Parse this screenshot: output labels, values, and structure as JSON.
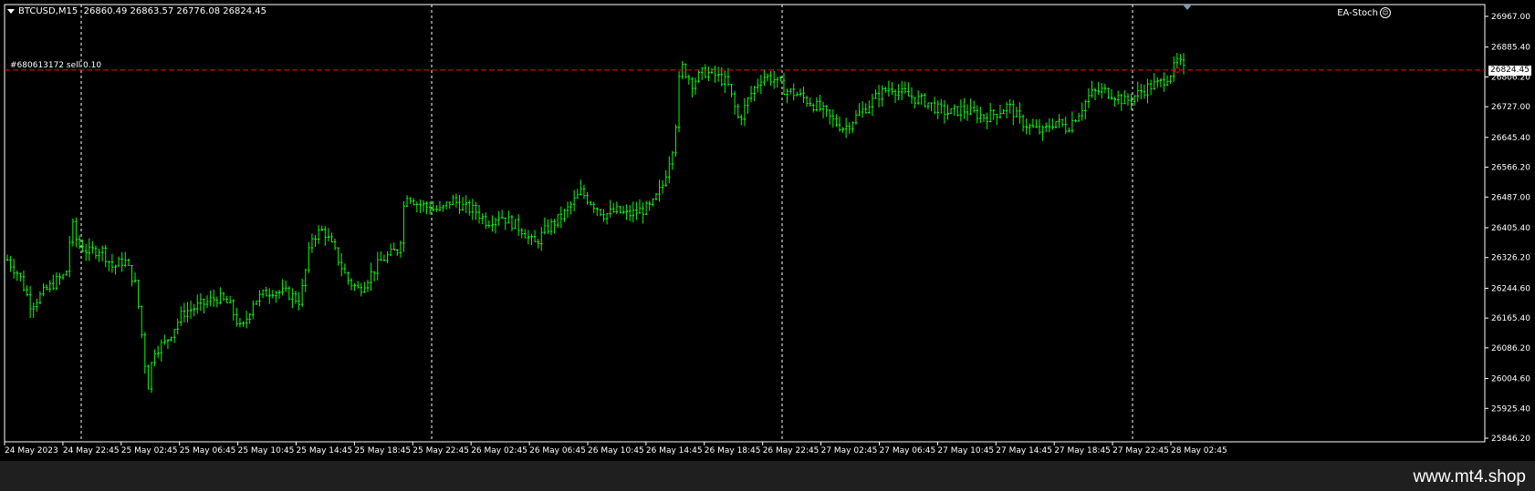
{
  "header": {
    "symbol_timeframe": "BTCUSD,M15",
    "ohlc": "26860.49 26863.57 26776.08 26824.45"
  },
  "expert": {
    "name": "EA-Stoch",
    "icon": "smiley-icon"
  },
  "order": {
    "label": "#680613172 sell 0.10",
    "price": 26824.45,
    "line_color": "#ff0000"
  },
  "current_price_label": "26824.45",
  "colors": {
    "background": "#000000",
    "candle": "#00ff00",
    "grid": "#ffffff",
    "axis_text": "#ffffff"
  },
  "watermark": "www.mt4.shop",
  "chart_data": {
    "type": "candlestick",
    "symbol": "BTCUSD",
    "timeframe": "M15",
    "y_ticks": [
      "26967.00",
      "26885.40",
      "26806.20",
      "26727.00",
      "26645.40",
      "26566.20",
      "26487.00",
      "26405.40",
      "26326.20",
      "26244.60",
      "26165.40",
      "26086.20",
      "26004.60",
      "25925.40",
      "25846.20"
    ],
    "ylim": [
      25846.2,
      26967.0
    ],
    "x_ticks": [
      "24 May 2023",
      "24 May 22:45",
      "25 May 02:45",
      "25 May 06:45",
      "25 May 10:45",
      "25 May 14:45",
      "25 May 18:45",
      "25 May 22:45",
      "26 May 02:45",
      "26 May 06:45",
      "26 May 10:45",
      "26 May 14:45",
      "26 May 18:45",
      "26 May 22:45",
      "27 May 02:45",
      "27 May 06:45",
      "27 May 10:45",
      "27 May 14:45",
      "27 May 18:45",
      "27 May 22:45",
      "28 May 02:45"
    ],
    "session_separators": [
      "24 May 2023",
      "25 May",
      "26 May",
      "27 May",
      "28 May"
    ],
    "price_path": [
      [
        0,
        26320
      ],
      [
        2,
        26280
      ],
      [
        4,
        26200
      ],
      [
        6,
        26230
      ],
      [
        8,
        26260
      ],
      [
        10,
        26280
      ],
      [
        11,
        26420
      ],
      [
        12,
        26360
      ],
      [
        14,
        26340
      ],
      [
        16,
        26350
      ],
      [
        18,
        26300
      ],
      [
        20,
        26320
      ],
      [
        22,
        26250
      ],
      [
        24,
        25980
      ],
      [
        25,
        26080
      ],
      [
        27,
        26100
      ],
      [
        30,
        26180
      ],
      [
        33,
        26200
      ],
      [
        36,
        26220
      ],
      [
        38,
        26200
      ],
      [
        40,
        26130
      ],
      [
        42,
        26210
      ],
      [
        45,
        26240
      ],
      [
        48,
        26230
      ],
      [
        50,
        26210
      ],
      [
        52,
        26380
      ],
      [
        54,
        26400
      ],
      [
        56,
        26340
      ],
      [
        58,
        26270
      ],
      [
        60,
        26240
      ],
      [
        62,
        26280
      ],
      [
        64,
        26320
      ],
      [
        67,
        26350
      ],
      [
        68,
        26500
      ],
      [
        70,
        26470
      ],
      [
        72,
        26460
      ],
      [
        74,
        26450
      ],
      [
        76,
        26480
      ],
      [
        78,
        26460
      ],
      [
        80,
        26450
      ],
      [
        82,
        26420
      ],
      [
        84,
        26440
      ],
      [
        86,
        26420
      ],
      [
        88,
        26400
      ],
      [
        90,
        26360
      ],
      [
        92,
        26400
      ],
      [
        95,
        26440
      ],
      [
        98,
        26500
      ],
      [
        100,
        26470
      ],
      [
        102,
        26440
      ],
      [
        104,
        26450
      ],
      [
        106,
        26440
      ],
      [
        108,
        26450
      ],
      [
        110,
        26460
      ],
      [
        112,
        26520
      ],
      [
        114,
        26640
      ],
      [
        115,
        26840
      ],
      [
        117,
        26790
      ],
      [
        119,
        26820
      ],
      [
        121,
        26810
      ],
      [
        123,
        26790
      ],
      [
        125,
        26690
      ],
      [
        127,
        26760
      ],
      [
        129,
        26810
      ],
      [
        131,
        26800
      ],
      [
        133,
        26770
      ],
      [
        135,
        26760
      ],
      [
        137,
        26740
      ],
      [
        139,
        26720
      ],
      [
        141,
        26690
      ],
      [
        143,
        26670
      ],
      [
        145,
        26700
      ],
      [
        147,
        26730
      ],
      [
        149,
        26760
      ],
      [
        151,
        26780
      ],
      [
        153,
        26760
      ],
      [
        155,
        26750
      ],
      [
        157,
        26740
      ],
      [
        159,
        26720
      ],
      [
        161,
        26710
      ],
      [
        163,
        26720
      ],
      [
        165,
        26710
      ],
      [
        167,
        26700
      ],
      [
        169,
        26710
      ],
      [
        171,
        26730
      ],
      [
        173,
        26690
      ],
      [
        175,
        26670
      ],
      [
        177,
        26660
      ],
      [
        179,
        26690
      ],
      [
        181,
        26670
      ],
      [
        183,
        26710
      ],
      [
        185,
        26760
      ],
      [
        187,
        26770
      ],
      [
        189,
        26760
      ],
      [
        191,
        26740
      ],
      [
        193,
        26760
      ],
      [
        195,
        26780
      ],
      [
        197,
        26790
      ],
      [
        199,
        26820
      ],
      [
        200,
        26850
      ],
      [
        201,
        26824
      ]
    ]
  }
}
